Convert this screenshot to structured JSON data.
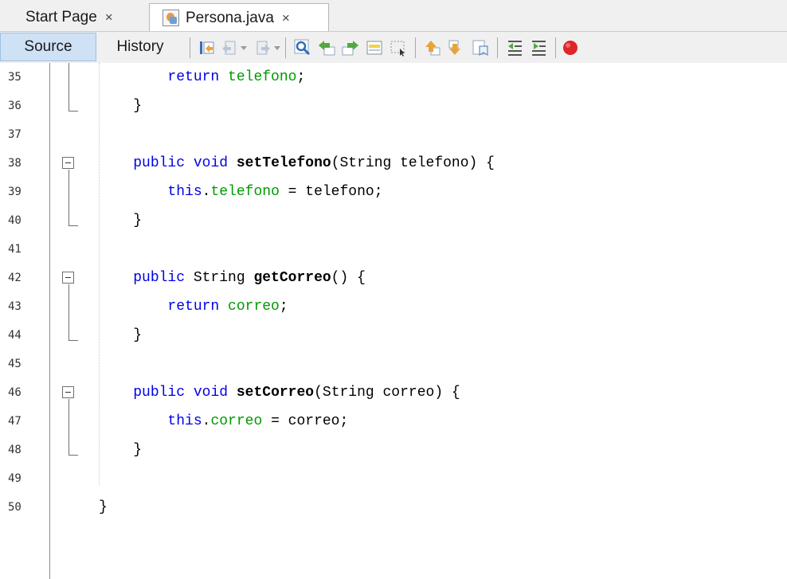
{
  "tabs": [
    {
      "label": "Start Page",
      "close": "×"
    },
    {
      "label": "Persona.java",
      "close": "×"
    }
  ],
  "toolbar": {
    "source_label": "Source",
    "history_label": "History",
    "icons": [
      "last-edit-icon",
      "back-icon",
      "forward-icon",
      "find-selection-icon",
      "find-previous-icon",
      "find-next-icon",
      "toggle-highlight-icon",
      "toggle-rect-selection-icon",
      "previous-bookmark-icon",
      "next-bookmark-icon",
      "toggle-bookmark-icon",
      "shift-left-icon",
      "shift-right-icon",
      "macro-record-icon"
    ]
  },
  "editor": {
    "lines": [
      {
        "num": "35",
        "segs": [
          {
            "t": "        "
          },
          {
            "t": "return",
            "c": "kw"
          },
          {
            "t": " "
          },
          {
            "t": "telefono",
            "c": "fld"
          },
          {
            "t": ";"
          }
        ]
      },
      {
        "num": "36",
        "segs": [
          {
            "t": "    }"
          }
        ]
      },
      {
        "num": "37",
        "segs": []
      },
      {
        "num": "38",
        "segs": [
          {
            "t": "    "
          },
          {
            "t": "public",
            "c": "kw"
          },
          {
            "t": " "
          },
          {
            "t": "void",
            "c": "kw"
          },
          {
            "t": " "
          },
          {
            "t": "setTelefono",
            "c": "mth"
          },
          {
            "t": "(String telefono) {"
          }
        ]
      },
      {
        "num": "39",
        "segs": [
          {
            "t": "        "
          },
          {
            "t": "this",
            "c": "kw"
          },
          {
            "t": "."
          },
          {
            "t": "telefono",
            "c": "fld"
          },
          {
            "t": " = telefono;"
          }
        ]
      },
      {
        "num": "40",
        "segs": [
          {
            "t": "    }"
          }
        ]
      },
      {
        "num": "41",
        "segs": []
      },
      {
        "num": "42",
        "segs": [
          {
            "t": "    "
          },
          {
            "t": "public",
            "c": "kw"
          },
          {
            "t": " String "
          },
          {
            "t": "getCorreo",
            "c": "mth"
          },
          {
            "t": "() {"
          }
        ]
      },
      {
        "num": "43",
        "segs": [
          {
            "t": "        "
          },
          {
            "t": "return",
            "c": "kw"
          },
          {
            "t": " "
          },
          {
            "t": "correo",
            "c": "fld"
          },
          {
            "t": ";"
          }
        ]
      },
      {
        "num": "44",
        "segs": [
          {
            "t": "    }"
          }
        ]
      },
      {
        "num": "45",
        "segs": []
      },
      {
        "num": "46",
        "segs": [
          {
            "t": "    "
          },
          {
            "t": "public",
            "c": "kw"
          },
          {
            "t": " "
          },
          {
            "t": "void",
            "c": "kw"
          },
          {
            "t": " "
          },
          {
            "t": "setCorreo",
            "c": "mth"
          },
          {
            "t": "(String correo) {"
          }
        ]
      },
      {
        "num": "47",
        "segs": [
          {
            "t": "        "
          },
          {
            "t": "this",
            "c": "kw"
          },
          {
            "t": "."
          },
          {
            "t": "correo",
            "c": "fld"
          },
          {
            "t": " = correo;"
          }
        ]
      },
      {
        "num": "48",
        "segs": [
          {
            "t": "    }"
          }
        ]
      },
      {
        "num": "49",
        "segs": []
      },
      {
        "num": "50",
        "segs": [
          {
            "t": "}"
          }
        ]
      }
    ]
  },
  "colors": {
    "keyword": "#0000e6",
    "field": "#009900",
    "source_active_bg": "#cfe1f5",
    "record_button": "#e0242a"
  }
}
